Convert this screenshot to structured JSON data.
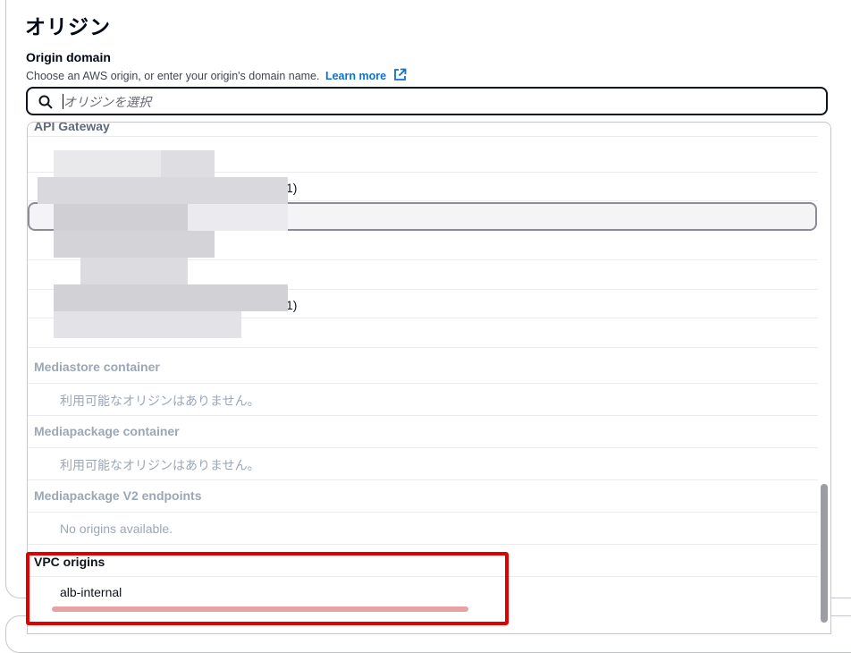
{
  "section_title": "オリジン",
  "origin_domain": {
    "label": "Origin domain",
    "description": "Choose an AWS origin, or enter your origin's domain name.",
    "learn_more": "Learn more",
    "search_placeholder": "オリジンを選択"
  },
  "dropdown": {
    "groups": [
      {
        "header": "API Gateway",
        "partial_items": [
          "1)",
          "1)"
        ]
      },
      {
        "header": "Mediastore container",
        "items": [
          "利用可能なオリジンはありません。"
        ]
      },
      {
        "header": "Mediapackage container",
        "items": [
          "利用可能なオリジンはありません。"
        ]
      },
      {
        "header": "Mediapackage V2 endpoints",
        "items": [
          "No origins available."
        ]
      },
      {
        "header": "VPC origins",
        "items": [
          "alb-internal"
        ]
      }
    ]
  },
  "colors": {
    "accent": "#0972d3",
    "highlight": "#df0000"
  }
}
